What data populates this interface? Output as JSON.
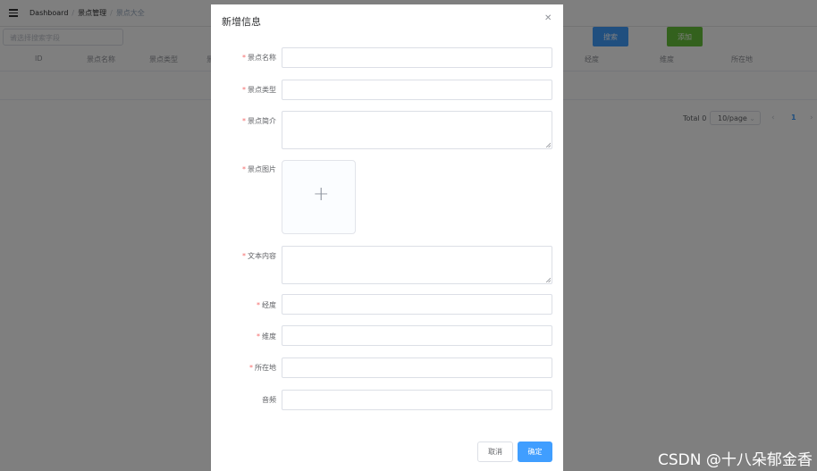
{
  "breadcrumb": {
    "items": [
      "Dashboard",
      "景点管理"
    ],
    "current": "景点大全"
  },
  "search": {
    "placeholder": "请选择搜索字段"
  },
  "toolbar": {
    "search_label": "搜索",
    "add_label": "添加"
  },
  "table": {
    "columns": [
      "ID",
      "景点名称",
      "景点类型",
      "景",
      "经度",
      "维度",
      "所在地"
    ]
  },
  "pagination": {
    "total": "Total 0",
    "page_size": "10/page",
    "current_page": "1"
  },
  "dialog": {
    "title": "新增信息",
    "fields": {
      "name": "景点名称",
      "type": "景点类型",
      "intro": "景点简介",
      "image": "景点图片",
      "content": "文本内容",
      "longitude": "经度",
      "latitude": "维度",
      "location": "所在地",
      "audio": "音频"
    },
    "cancel_label": "取消",
    "confirm_label": "确定"
  },
  "watermark": "CSDN @十八朵郁金香",
  "colors": {
    "primary": "#409eff",
    "success": "#67c23a",
    "required": "#f56c6c"
  }
}
